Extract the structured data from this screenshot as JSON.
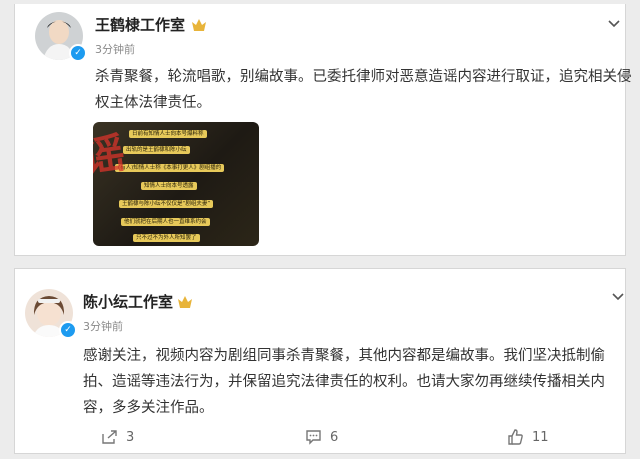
{
  "colors": {
    "background": "#ececec",
    "card": "#ffffff",
    "text": "#333333",
    "muted": "#8a8a8a",
    "verified": "#1d9bf0",
    "badge": "#e8b43a"
  },
  "posts": [
    {
      "author": "王鹤棣工作室",
      "time": "3分钟前",
      "badge_icon": "crown-icon",
      "verified_icon": "verified-icon",
      "text": "杀青聚餐，轮流唱歌，别编故事。已委托律师对恶意造谣内容进行取证，追究相关侵权主体法律责任。",
      "image": {
        "stamp": "谣",
        "bubbles": [
          "日前有知情人士向本号爆料称",
          "出轨的是王鹤棣和陈小纭",
          "(有人)知情人士称《本事打更人》剧组播的",
          "王鹤棣与陈小纭不仅仅是“剧组夫妻”",
          "知情人士向本号透露",
          "他们就把在后期人也一直维系约会",
          "只不过不为外人所知罢了"
        ]
      }
    },
    {
      "author": "陈小纭工作室",
      "time": "3分钟前",
      "badge_icon": "crown-icon",
      "verified_icon": "verified-icon",
      "text": "感谢关注，视频内容为剧组同事杀青聚餐，其他内容都是编故事。我们坚决抵制偷拍、造谣等违法行为，并保留追究法律责任的权利。也请大家勿再继续传播相关内容，多多关注作品。",
      "actions": {
        "share_icon": "share-icon",
        "share_count": "3",
        "comment_icon": "comment-icon",
        "comment_count": "6",
        "like_icon": "thumbs-up-icon",
        "like_count": "11"
      }
    }
  ]
}
